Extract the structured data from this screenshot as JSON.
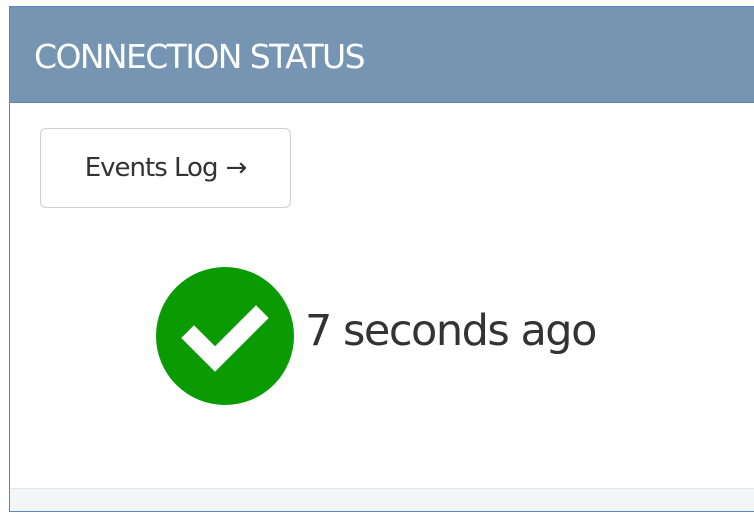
{
  "panel": {
    "title": "CONNECTION STATUS",
    "events_button_label": "Events Log",
    "events_button_arrow": "→",
    "status": {
      "icon": "check-circle-icon",
      "icon_color": "#0a9b00",
      "text": "7 seconds ago"
    }
  },
  "colors": {
    "header_background": "#7595b3",
    "border_accent": "#5b86c9"
  }
}
